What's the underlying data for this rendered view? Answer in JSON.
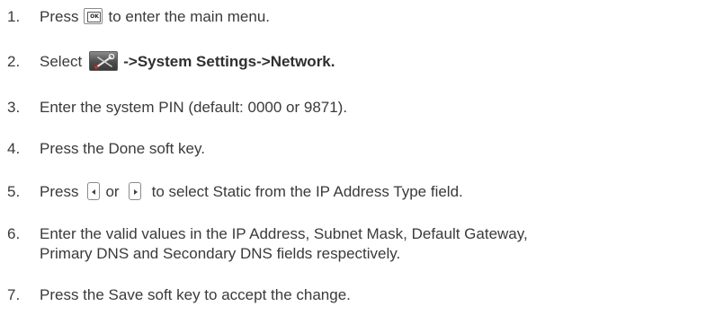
{
  "steps": [
    {
      "number": "1.",
      "before": "Press",
      "icon": "ok-key-icon",
      "after": "to enter the main menu."
    },
    {
      "number": "2.",
      "before": "Select",
      "icon": "system-settings-icon",
      "after_bold": "->System Settings->Network."
    },
    {
      "number": "3.",
      "text": "Enter the system PIN (default: 0000 or 9871)."
    },
    {
      "number": "4.",
      "text": "Press the Done soft key."
    },
    {
      "number": "5.",
      "before": "Press",
      "icon_left": "left-navigation-key-icon",
      "middle": "or",
      "icon_right": "right-navigation-key-icon",
      "after": "to select Static from the IP Address Type field."
    },
    {
      "number": "6.",
      "line1": "Enter the valid values in the IP Address, Subnet Mask, Default Gateway,",
      "line2": "Primary DNS and Secondary DNS fields respectively."
    },
    {
      "number": "7.",
      "text": "Press the Save soft key to accept the change."
    }
  ],
  "ok_key_label": "OK"
}
